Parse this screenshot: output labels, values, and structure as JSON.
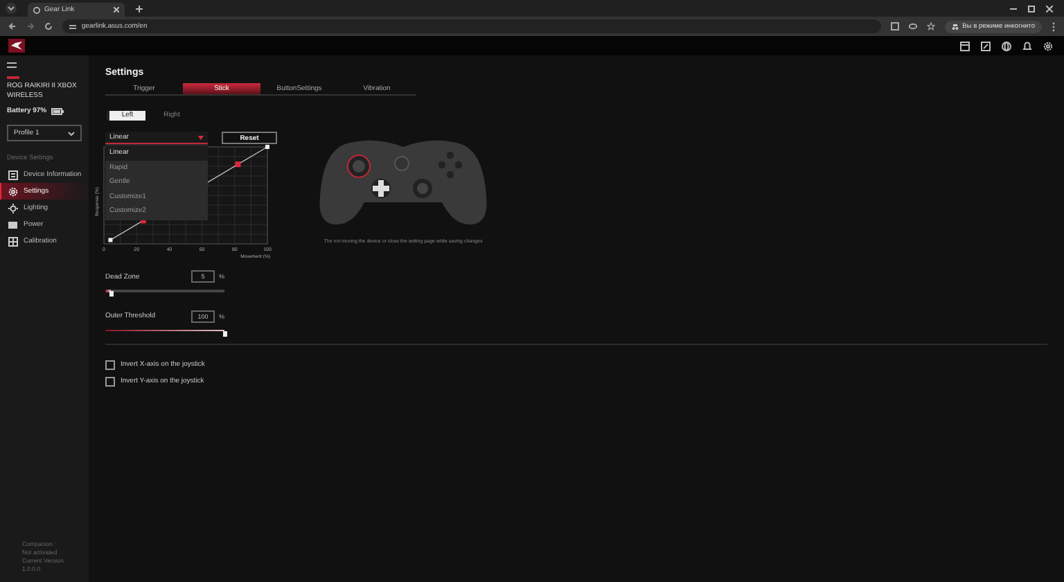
{
  "browser": {
    "tab_title": "Gear Link",
    "url": "gearlink.asus.com/en",
    "incognito_label": "Вы в режиме инкогнито"
  },
  "sidebar": {
    "device_name": "ROG RAIKIRI II XBOX WIRELESS",
    "battery": "Battery 97%",
    "profile": "Profile 1",
    "section_label": "Device Settings",
    "items": [
      {
        "label": "Device Information",
        "selected": false
      },
      {
        "label": "Settings",
        "selected": true
      },
      {
        "label": "Lighting",
        "selected": false
      },
      {
        "label": "Power",
        "selected": false
      },
      {
        "label": "Calibration",
        "selected": false
      }
    ],
    "footer": [
      "Companion : Not activated",
      "Current Version: 1.0.0.0"
    ]
  },
  "page_title": "Settings",
  "tabs": [
    {
      "label": "Trigger",
      "selected": false
    },
    {
      "label": "Stick",
      "selected": true
    },
    {
      "label": "ButtonSettings",
      "selected": false
    },
    {
      "label": "Vibration",
      "selected": false
    }
  ],
  "side_toggle": [
    {
      "label": "Left",
      "selected": true
    },
    {
      "label": "Right",
      "selected": false
    }
  ],
  "curve_select": {
    "value": "Linear",
    "expanded": true,
    "options": [
      {
        "label": "Linear",
        "selected": true
      },
      {
        "label": "Rapid",
        "selected": false
      },
      {
        "label": "Gentle",
        "selected": false
      },
      {
        "label": "Customize1",
        "selected": false
      },
      {
        "label": "Customize2",
        "selected": false
      }
    ]
  },
  "reset_button": "Reset",
  "curve_graph": {
    "xlabel": "Movement (%)",
    "ylabel": "Response (%)",
    "xticks": [
      "0",
      "20",
      "40",
      "60",
      "80",
      "100"
    ]
  },
  "controller_note": "The not moving the device or close the setting page while saving changes",
  "sliders": [
    {
      "label": "Dead Zone",
      "value": "5",
      "unit": "%",
      "level": 0.05
    },
    {
      "label": "Outer Threshold",
      "value": "100",
      "unit": "%",
      "level": 1
    }
  ],
  "checkboxes": [
    {
      "label": "Invert X-axis on the joystick",
      "checked": false
    },
    {
      "label": "Invert Y-axis on the joystick",
      "checked": false
    }
  ]
}
